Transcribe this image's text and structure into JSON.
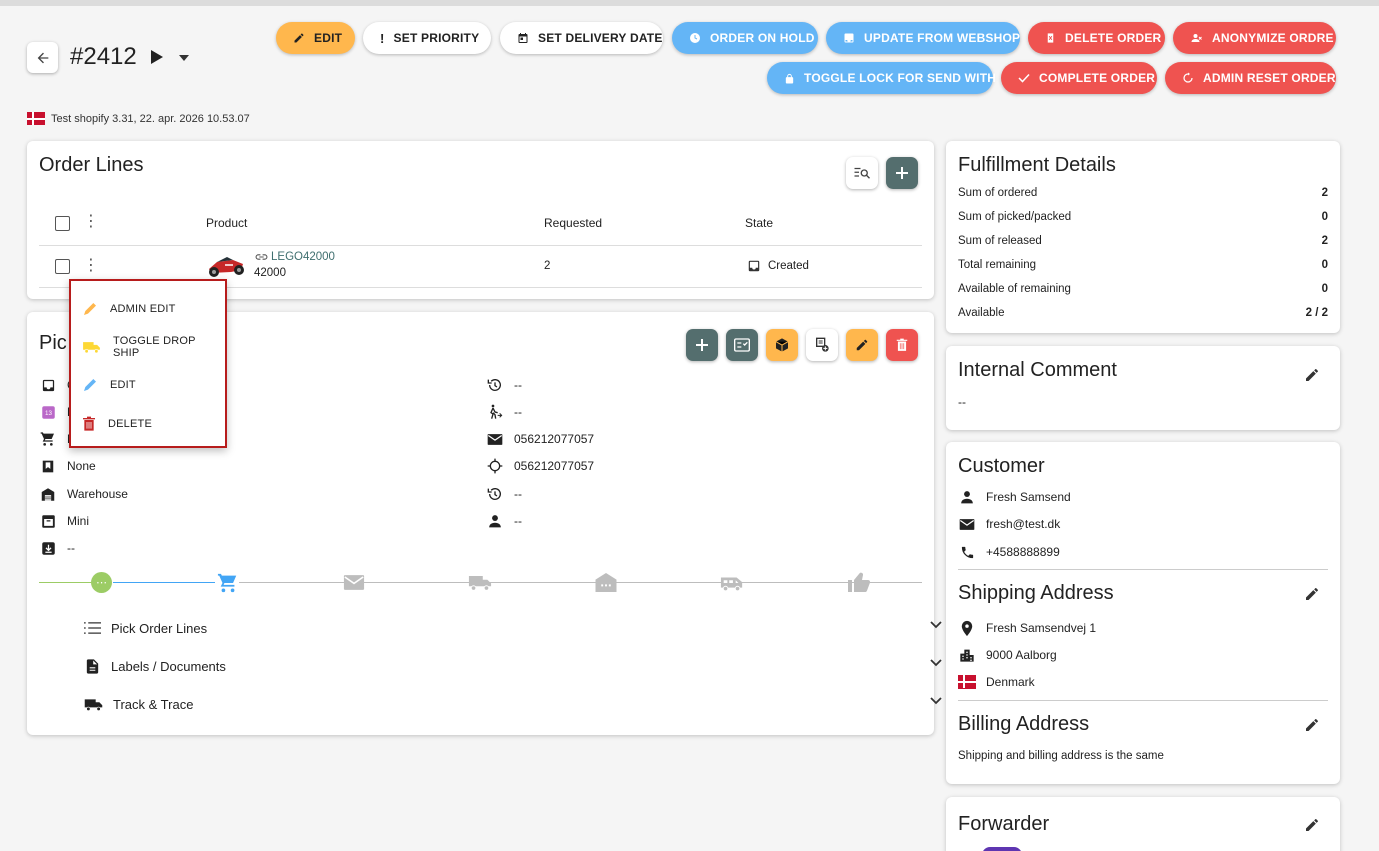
{
  "header": {
    "order_number": "#2412",
    "shop_line": "Test shopify 3.31, 22. apr. 2026 10.53.07"
  },
  "actions": {
    "edit": "EDIT",
    "set_priority": "SET PRIORITY",
    "set_delivery_date": "SET DELIVERY DATE",
    "order_on_hold": "ORDER ON HOLD",
    "update_from_webshop": "UPDATE FROM WEBSHOP",
    "delete_order": "DELETE ORDER",
    "anonymize": "ANONYMIZE ORDRE",
    "toggle_lock": "TOGGLE LOCK FOR SEND WITH",
    "complete_order": "COMPLETE ORDER",
    "admin_reset": "ADMIN RESET ORDER"
  },
  "colors": {
    "orange": "#ffb74d",
    "blue": "#64b5f6",
    "red": "#ef5350",
    "teal": "#546e6e",
    "menu_border": "#b71c1c",
    "timeline_green": "#9ccc65",
    "timeline_blue": "#42a5f5"
  },
  "order_lines": {
    "title": "Order Lines",
    "columns": {
      "product": "Product",
      "requested": "Requested",
      "state": "State"
    },
    "rows": [
      {
        "link": "LEGO42000",
        "sku": "42000",
        "requested": "2",
        "state": "Created"
      }
    ]
  },
  "context_menu": {
    "items": [
      {
        "label": "ADMIN EDIT",
        "icon": "pencil-icon"
      },
      {
        "label": "TOGGLE DROP SHIP",
        "icon": "truck-icon"
      },
      {
        "label": "EDIT",
        "icon": "pencil-icon"
      },
      {
        "label": "DELETE",
        "icon": "trash-icon"
      }
    ]
  },
  "pick_order": {
    "title_visible": "Pic",
    "left_rows": [
      {
        "icon": "inbox-icon",
        "text": "C"
      },
      {
        "icon": "calendar-icon",
        "text": "F"
      },
      {
        "icon": "cart-icon",
        "text": "N"
      },
      {
        "icon": "bookmark-icon",
        "text": "None"
      },
      {
        "icon": "warehouse-icon",
        "text": "Warehouse"
      },
      {
        "icon": "archive-icon",
        "text": "Mini"
      },
      {
        "icon": "download-box-icon",
        "text": "--"
      }
    ],
    "right_rows": [
      {
        "icon": "history-icon",
        "text": "--"
      },
      {
        "icon": "person-walk-icon",
        "text": "--"
      },
      {
        "icon": "mail-icon",
        "text": "056212077057"
      },
      {
        "icon": "crosshair-icon",
        "text": "056212077057"
      },
      {
        "icon": "history-icon",
        "text": "--"
      },
      {
        "icon": "person-icon",
        "text": "--"
      }
    ],
    "accordions": [
      {
        "icon": "list-icon",
        "label": "Pick Order Lines"
      },
      {
        "icon": "document-icon",
        "label": "Labels / Documents"
      },
      {
        "icon": "truck-icon",
        "label": "Track & Trace"
      }
    ]
  },
  "fulfillment": {
    "title": "Fulfillment Details",
    "rows": [
      {
        "label": "Sum of ordered",
        "value": "2"
      },
      {
        "label": "Sum of picked/packed",
        "value": "0"
      },
      {
        "label": "Sum of released",
        "value": "2"
      },
      {
        "label": "Total remaining",
        "value": "0"
      },
      {
        "label": "Available of remaining",
        "value": "0"
      },
      {
        "label": "Available",
        "value": "2 / 2"
      }
    ]
  },
  "internal_comment": {
    "title": "Internal Comment",
    "text": "--"
  },
  "customer": {
    "title": "Customer",
    "name": "Fresh Samsend",
    "email": "fresh@test.dk",
    "phone": "+4588888899"
  },
  "shipping": {
    "title": "Shipping Address",
    "street": "Fresh Samsendvej 1",
    "city": "9000 Aalborg",
    "country": "Denmark"
  },
  "billing": {
    "title": "Billing Address",
    "text": "Shipping and billing address is the same"
  },
  "forwarder": {
    "title": "Forwarder"
  }
}
